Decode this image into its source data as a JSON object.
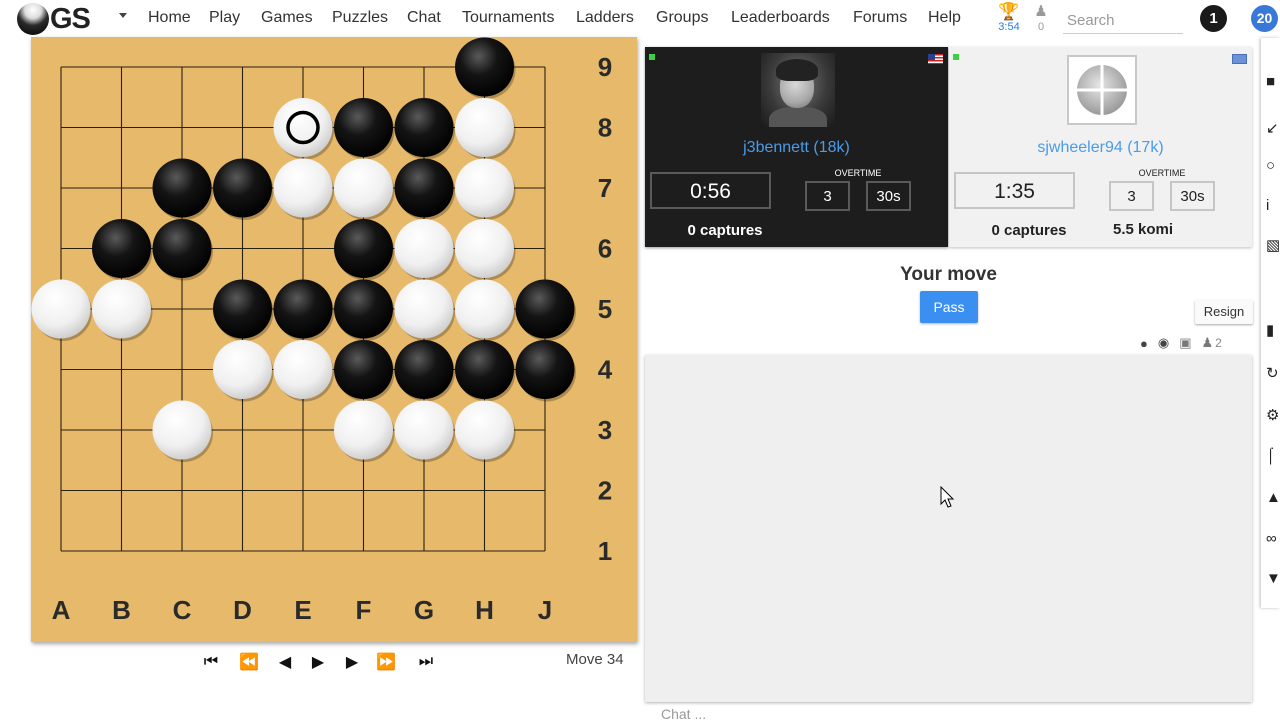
{
  "brand": {
    "logo_text": "GS"
  },
  "nav": {
    "items": [
      "Home",
      "Play",
      "Games",
      "Puzzles",
      "Chat",
      "Tournaments",
      "Ladders",
      "Groups",
      "Leaderboards",
      "Forums",
      "Help"
    ]
  },
  "header": {
    "tournament_time": "3:54",
    "online_friends": "0",
    "search_placeholder": "Search",
    "notification_count": "1",
    "user_badge": "20"
  },
  "board": {
    "size": 9,
    "columns": [
      "A",
      "B",
      "C",
      "D",
      "E",
      "F",
      "G",
      "H",
      "J"
    ],
    "rows": [
      "9",
      "8",
      "7",
      "6",
      "5",
      "4",
      "3",
      "2",
      "1"
    ],
    "black_stones": [
      "H9",
      "F8",
      "G8",
      "C7",
      "D7",
      "G7",
      "B6",
      "C6",
      "F6",
      "D5",
      "E5",
      "F5",
      "J5",
      "F4",
      "G4",
      "H4",
      "J4"
    ],
    "white_stones": [
      "E8",
      "H8",
      "E7",
      "F7",
      "H7",
      "G6",
      "H6",
      "A5",
      "B5",
      "G5",
      "H5",
      "D4",
      "E4",
      "C3",
      "F3",
      "G3",
      "H3"
    ],
    "last_move": "E8",
    "colors": {
      "wood": "#e7b96a",
      "line": "#2a2010"
    }
  },
  "move_controls": {
    "buttons": [
      "first-move",
      "back-ten",
      "previous",
      "play",
      "next",
      "forward-ten",
      "last-move"
    ],
    "move_label": "Move 34"
  },
  "players": {
    "black": {
      "name": "j3bennett (18k)",
      "clock": "0:56",
      "overtime_label": "OVERTIME",
      "periods": "3",
      "period_time": "30s",
      "captures": "0 captures",
      "flag": "us-flag"
    },
    "white": {
      "name": "sjwheeler94 (17k)",
      "clock": "1:35",
      "overtime_label": "OVERTIME",
      "periods": "3",
      "period_time": "30s",
      "captures": "0 captures",
      "komi": "5.5 komi",
      "flag": "un-flag"
    }
  },
  "actions": {
    "status": "Your move",
    "pass_label": "Pass",
    "resign_label": "Resign"
  },
  "chat": {
    "viewer_count": "2",
    "input_placeholder": "Chat ..."
  },
  "colors": {
    "accent_link": "#4a9be8",
    "pass_button": "#3a8ff0",
    "online": "#3fcf3f"
  }
}
